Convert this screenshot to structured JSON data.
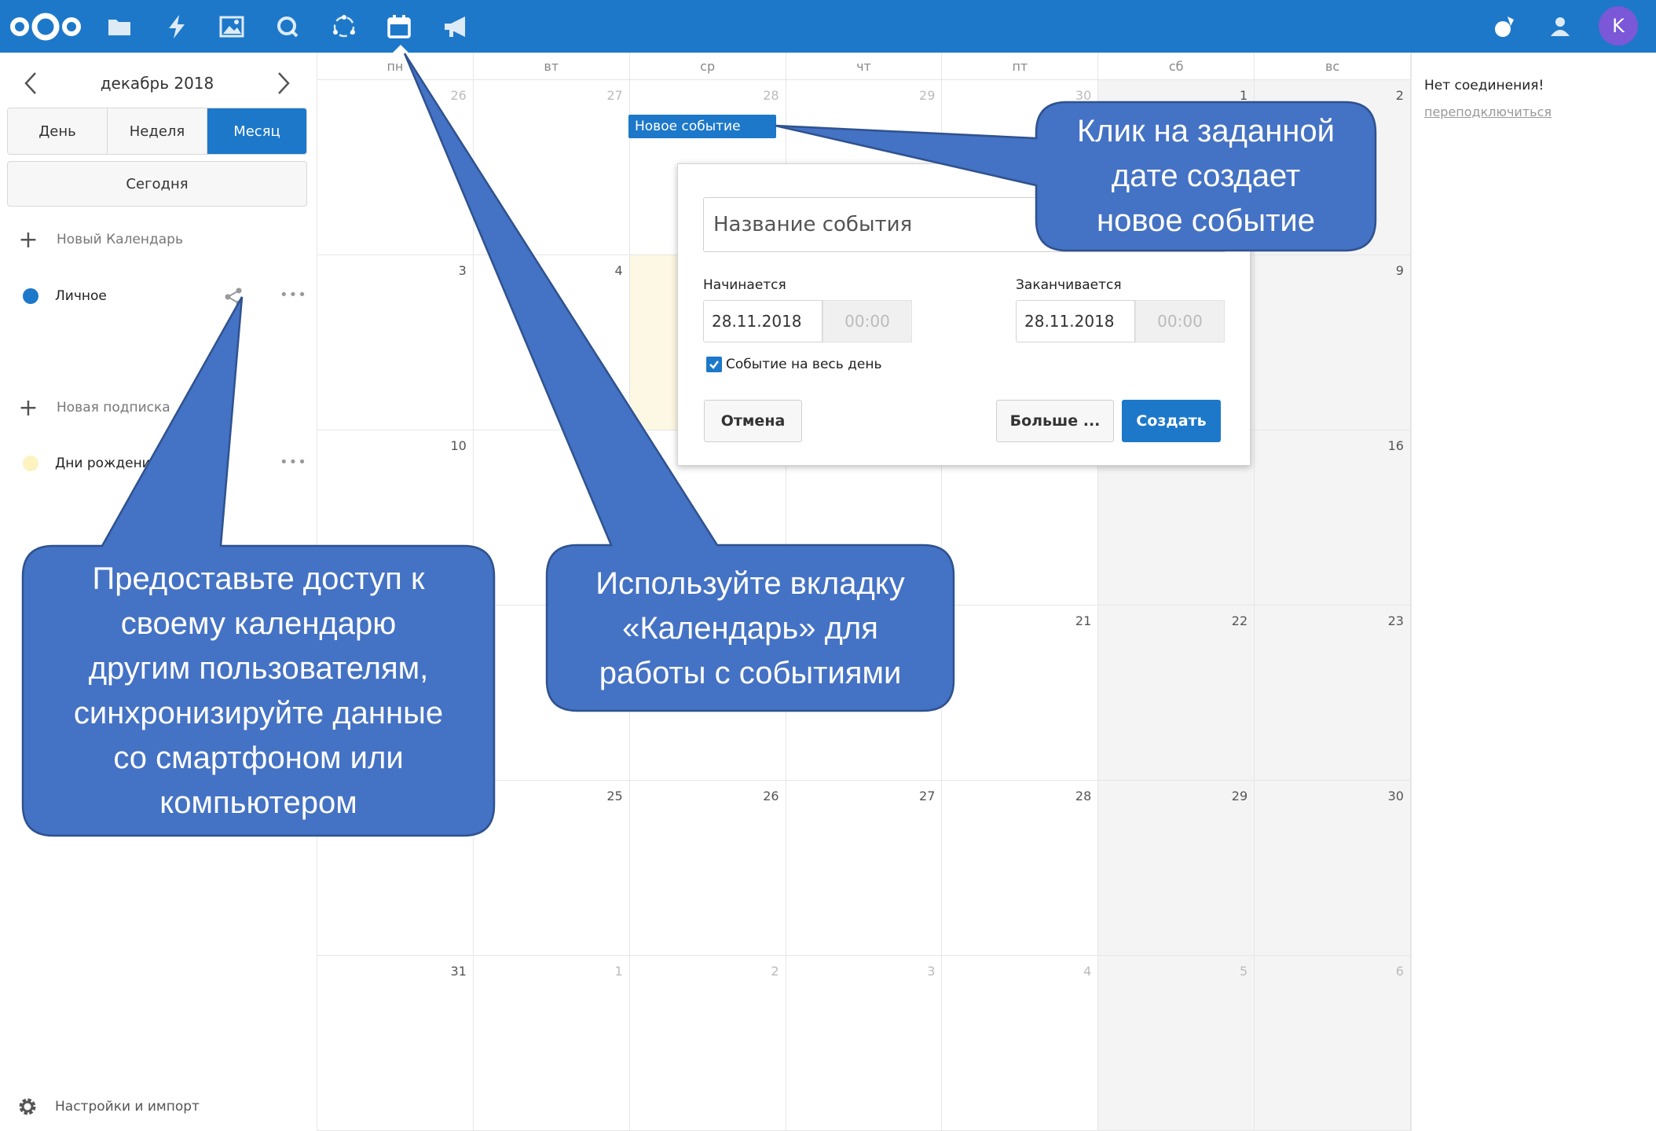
{
  "colors": {
    "brand": "#1d78c9",
    "avatar": "#7a58d8",
    "callout": "#4472c4",
    "callout_border": "#2f528f"
  },
  "topbar": {
    "apps": [
      "nextcloud-logo-icon",
      "files-icon",
      "activity-icon",
      "photos-icon",
      "search-icon",
      "circles-icon",
      "calendar-icon",
      "announcements-icon"
    ],
    "right_icons": [
      "notifications-icon",
      "contacts-icon"
    ],
    "avatar_letter": "K"
  },
  "sidebar": {
    "month_label": "декабрь 2018",
    "views": [
      "День",
      "Неделя",
      "Месяц"
    ],
    "today": "Сегодня",
    "new_calendar": "Новый Календарь",
    "calendars": [
      {
        "name": "Личное",
        "color": "#1d78c9"
      }
    ],
    "new_subscription": "Новая подписка",
    "subscriptions": [
      {
        "name": "Дни рождени",
        "color": "#fcf3c0"
      }
    ],
    "more": "•••",
    "settings": "Настройки и импорт"
  },
  "calendar": {
    "weekdays": [
      "пн",
      "вт",
      "ср",
      "чт",
      "пт",
      "сб",
      "вс"
    ],
    "weeks": [
      [
        "26",
        "27",
        "28",
        "29",
        "30",
        "1",
        "2"
      ],
      [
        "3",
        "4",
        "",
        "",
        "",
        "",
        "9"
      ],
      [
        "10",
        "",
        "",
        "",
        "",
        "",
        "16"
      ],
      [
        "",
        "",
        "",
        "",
        "21",
        "22",
        "23"
      ],
      [
        "",
        "25",
        "26",
        "27",
        "28",
        "29",
        "30"
      ],
      [
        "31",
        "1",
        "2",
        "3",
        "4",
        "5",
        "6"
      ]
    ],
    "event_chip": "Новое событие"
  },
  "popup": {
    "title_placeholder": "Название события",
    "starts_label": "Начинается",
    "ends_label": "Заканчивается",
    "start_date": "28.11.2018",
    "start_time": "00:00",
    "end_date": "28.11.2018",
    "end_time": "00:00",
    "all_day": "Событие на весь день",
    "cancel": "Отмена",
    "more": "Больше ...",
    "create": "Создать"
  },
  "right_panel": {
    "title": "Нет соединения!",
    "link": "переподключиться"
  },
  "callouts": {
    "share": [
      "Предоставьте доступ к",
      "своему календарю",
      "другим пользователям,",
      "синхронизируйте данные",
      "со смартфоном  или",
      "компьютером"
    ],
    "calendar_tab": [
      "Используйте вкладку",
      "«Календарь» для",
      "работы с событиями"
    ],
    "click_date": [
      "Клик на заданной",
      "дате создает",
      "новое событие"
    ]
  }
}
